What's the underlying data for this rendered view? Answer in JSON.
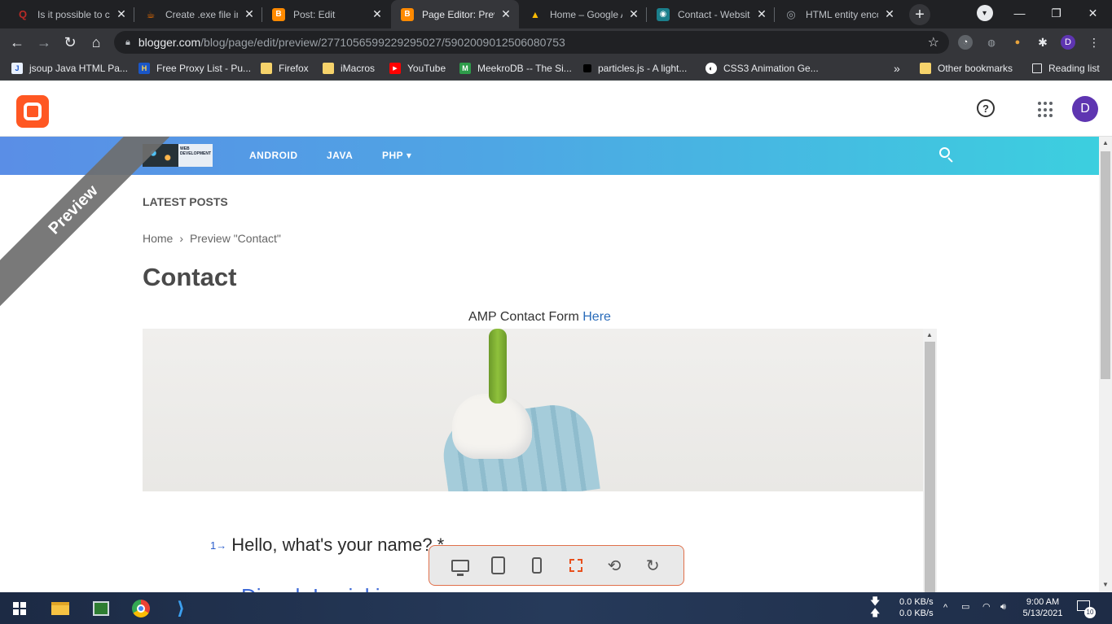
{
  "tabs": [
    {
      "label": "Is it possible to cr",
      "fav_color": "#b92b27",
      "fav_glyph": "Q"
    },
    {
      "label": "Create .exe file in",
      "fav_color": "#e86c00",
      "fav_glyph": "☕"
    },
    {
      "label": "Post: Edit",
      "fav_color": "#ff8a00",
      "fav_glyph": "B"
    },
    {
      "label": "Page Editor: Previ",
      "fav_color": "#ff8a00",
      "fav_glyph": "B"
    },
    {
      "label": "Home – Google A",
      "fav_color": "#fbbc04",
      "fav_glyph": "▲"
    },
    {
      "label": "Contact - Website",
      "fav_color": "#1b7f8c",
      "fav_glyph": "◉"
    },
    {
      "label": "HTML entity enco",
      "fav_color": "#5f6368",
      "fav_glyph": "◎"
    }
  ],
  "address": {
    "host": "blogger.com",
    "path": "/blog/page/edit/preview/2771056599229295027/5902009012506080753"
  },
  "bookmarks": [
    {
      "label": "jsoup Java HTML Pa...",
      "color": "#e8f0fe",
      "glyph": "J"
    },
    {
      "label": "Free Proxy List - Pu...",
      "color": "#1a56c7",
      "glyph": "H"
    },
    {
      "label": "Firefox",
      "color": "#f6d36b",
      "glyph": ""
    },
    {
      "label": "iMacros",
      "color": "#f6d36b",
      "glyph": ""
    },
    {
      "label": "YouTube",
      "color": "#ff0000",
      "glyph": "▶"
    },
    {
      "label": "MeekroDB -- The Si...",
      "color": "#2e9c4a",
      "glyph": "M"
    },
    {
      "label": "particles.js - A light...",
      "color": "#000000",
      "glyph": ""
    },
    {
      "label": "CSS3 Animation Ge...",
      "color": "#ffffff",
      "glyph": "◐"
    }
  ],
  "bookmarks_right": {
    "overflow": "»",
    "other": "Other bookmarks",
    "reading": "Reading list"
  },
  "blogger": {
    "avatar_letter": "D",
    "help": "?"
  },
  "site": {
    "logo_text": "WEB DEVELOPMENT",
    "nav": [
      "ANDROID",
      "JAVA",
      "PHP"
    ],
    "nav_caret": "▾"
  },
  "ribbon": "Preview",
  "page": {
    "latest": "LATEST POSTS",
    "crumb_home": "Home",
    "crumb_sep": "›",
    "crumb_current": "Preview \"Contact\"",
    "title": "Contact",
    "amp_text": "AMP Contact Form",
    "amp_link": "Here"
  },
  "form": {
    "q_number": "1",
    "q_arrow": "→",
    "question": "Hello, what's your name? *",
    "answer_partial": "Dinesh Lanjaki"
  },
  "device_bar": [
    "desktop-icon",
    "tablet-icon",
    "phone-icon",
    "fullscreen-icon",
    "rotate-icon",
    "reload-icon"
  ],
  "taskbar": {
    "net_down": "0.0 KB/s",
    "net_up": "0.0 KB/s",
    "time": "9:00 AM",
    "date": "5/13/2021",
    "notif": "10"
  }
}
